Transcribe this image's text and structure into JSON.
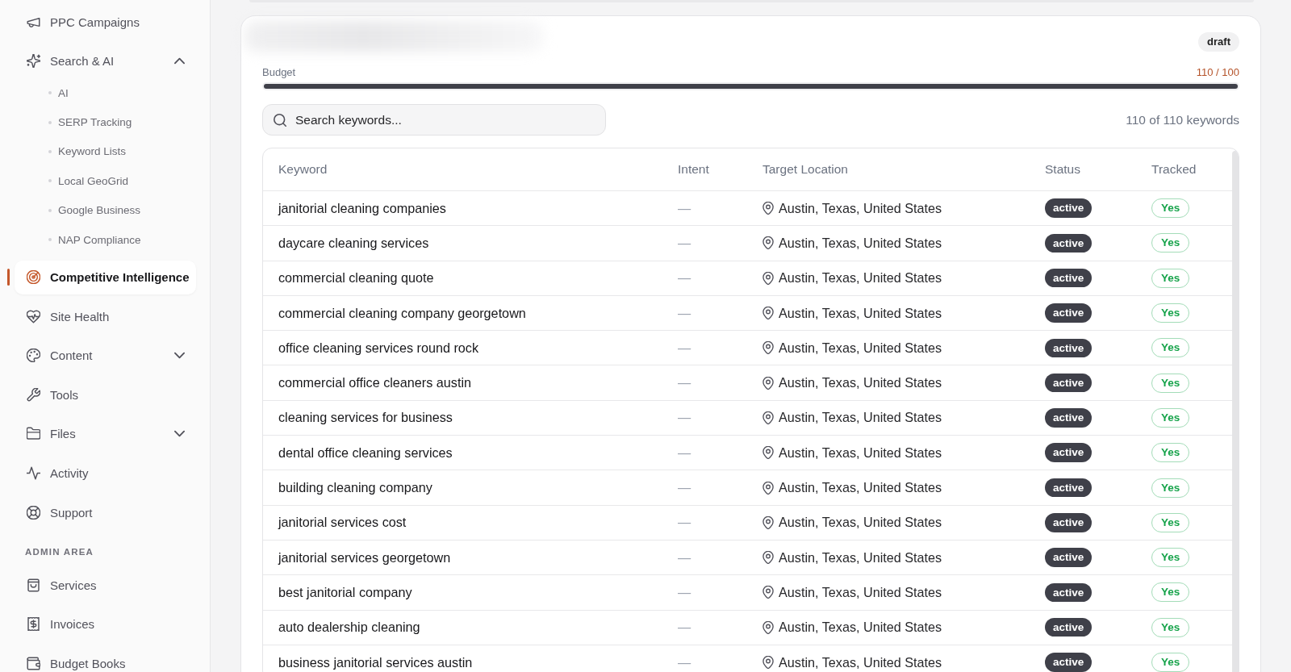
{
  "sidebar": {
    "items": [
      {
        "kind": "link",
        "label": "PPC Campaigns",
        "selected": false
      },
      {
        "kind": "group",
        "label": "Search & AI",
        "selected": false,
        "expanded": true,
        "children": [
          {
            "label": "AI",
            "selected": false
          },
          {
            "label": "SERP Tracking",
            "selected": false
          },
          {
            "label": "Keyword Lists",
            "selected": false
          },
          {
            "label": "Local GeoGrid",
            "selected": false
          },
          {
            "label": "Google Business",
            "selected": false
          },
          {
            "label": "NAP Compliance",
            "selected": false
          }
        ]
      },
      {
        "kind": "link",
        "label": "Competitive Intelligence",
        "selected": true
      },
      {
        "kind": "link",
        "label": "Site Health",
        "selected": false
      },
      {
        "kind": "group",
        "label": "Content",
        "selected": false,
        "expanded": false
      },
      {
        "kind": "link",
        "label": "Tools",
        "selected": false
      },
      {
        "kind": "group",
        "label": "Files",
        "selected": false,
        "expanded": false
      },
      {
        "kind": "link",
        "label": "Activity",
        "selected": false
      },
      {
        "kind": "link",
        "label": "Support",
        "selected": false
      },
      {
        "kind": "heading",
        "label": "ADMIN AREA"
      },
      {
        "kind": "link",
        "label": "Services",
        "selected": false
      },
      {
        "kind": "link",
        "label": "Invoices",
        "selected": false
      },
      {
        "kind": "link",
        "label": "Budget Books",
        "selected": false
      }
    ]
  },
  "campaign": {
    "status": "draft",
    "budget": {
      "label": "Budget",
      "reading": "110 / 100",
      "level": 1,
      "over_limit": true
    }
  },
  "search": {
    "placeholder": "Search keywords...",
    "count": "110 of 110 keywords"
  },
  "table": {
    "columns": [
      "Keyword",
      "Intent",
      "Target Location",
      "Status",
      "Tracked"
    ],
    "rows": [
      {
        "keyword": "janitorial cleaning companies",
        "intent": "—",
        "location": "Austin, Texas, United States",
        "status": "active",
        "tracked": "Yes"
      },
      {
        "keyword": "daycare cleaning services",
        "intent": "—",
        "location": "Austin, Texas, United States",
        "status": "active",
        "tracked": "Yes"
      },
      {
        "keyword": "commercial cleaning quote",
        "intent": "—",
        "location": "Austin, Texas, United States",
        "status": "active",
        "tracked": "Yes"
      },
      {
        "keyword": "commercial cleaning company georgetown",
        "intent": "—",
        "location": "Austin, Texas, United States",
        "status": "active",
        "tracked": "Yes"
      },
      {
        "keyword": "office cleaning services round rock",
        "intent": "—",
        "location": "Austin, Texas, United States",
        "status": "active",
        "tracked": "Yes"
      },
      {
        "keyword": "commercial office cleaners austin",
        "intent": "—",
        "location": "Austin, Texas, United States",
        "status": "active",
        "tracked": "Yes"
      },
      {
        "keyword": "cleaning services for business",
        "intent": "—",
        "location": "Austin, Texas, United States",
        "status": "active",
        "tracked": "Yes"
      },
      {
        "keyword": "dental office cleaning services",
        "intent": "—",
        "location": "Austin, Texas, United States",
        "status": "active",
        "tracked": "Yes"
      },
      {
        "keyword": "building cleaning company",
        "intent": "—",
        "location": "Austin, Texas, United States",
        "status": "active",
        "tracked": "Yes"
      },
      {
        "keyword": "janitorial services cost",
        "intent": "—",
        "location": "Austin, Texas, United States",
        "status": "active",
        "tracked": "Yes"
      },
      {
        "keyword": "janitorial services georgetown",
        "intent": "—",
        "location": "Austin, Texas, United States",
        "status": "active",
        "tracked": "Yes"
      },
      {
        "keyword": "best janitorial company",
        "intent": "—",
        "location": "Austin, Texas, United States",
        "status": "active",
        "tracked": "Yes"
      },
      {
        "keyword": "auto dealership cleaning",
        "intent": "—",
        "location": "Austin, Texas, United States",
        "status": "active",
        "tracked": "Yes"
      },
      {
        "keyword": "business janitorial services austin",
        "intent": "—",
        "location": "Austin, Texas, United States",
        "status": "active",
        "tracked": "Yes"
      }
    ]
  }
}
